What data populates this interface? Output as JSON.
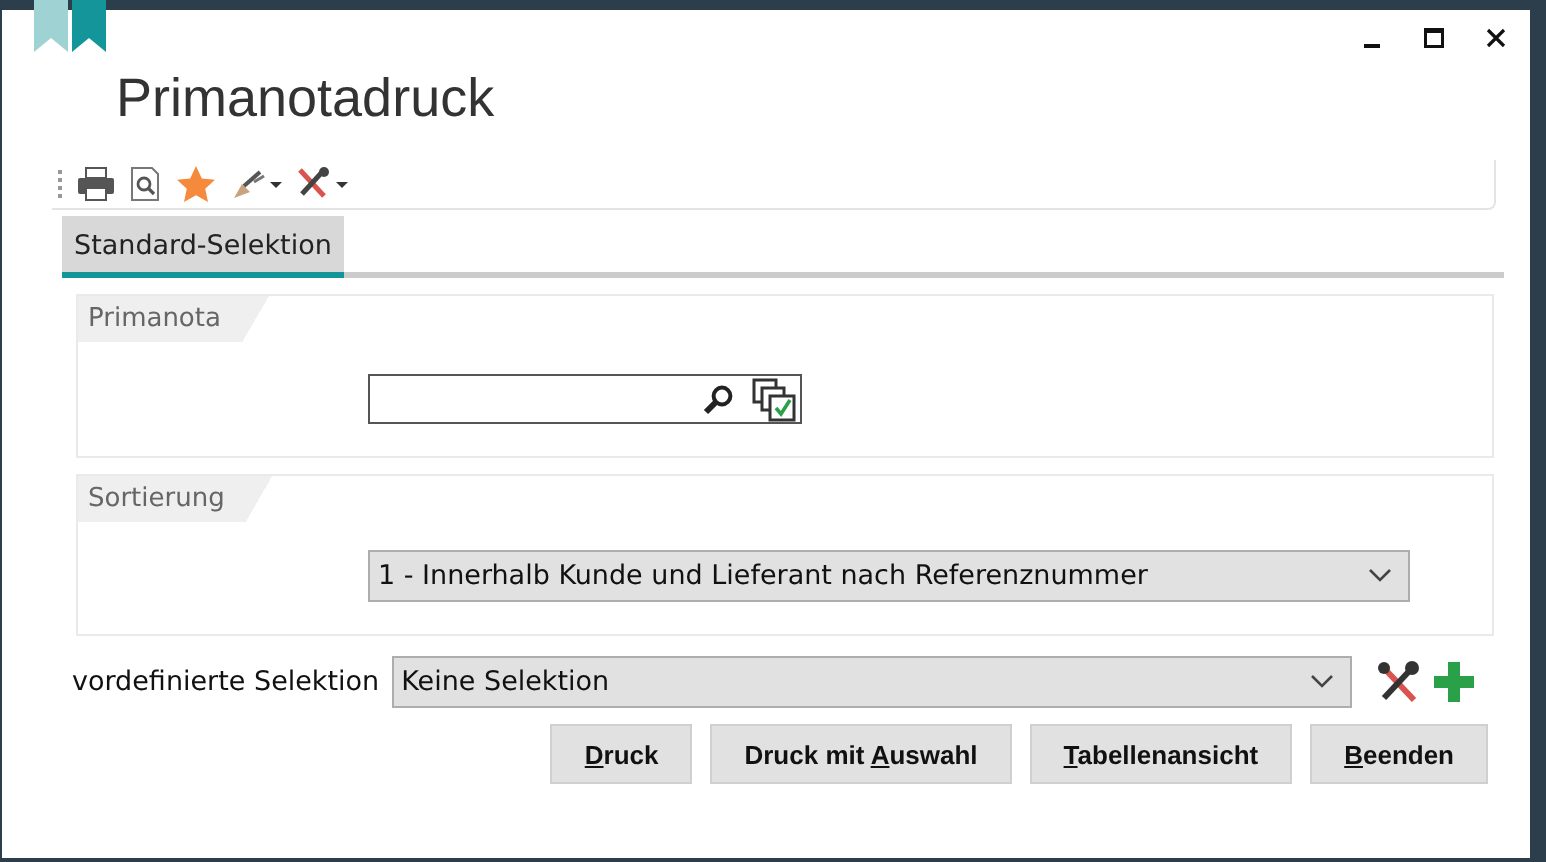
{
  "window": {
    "title": "Primanotadruck"
  },
  "tabs": [
    {
      "label": "Standard-Selektion",
      "selected": true
    }
  ],
  "groups": [
    {
      "title": "Primanota",
      "kind": "lookup"
    },
    {
      "title": "Sortierung",
      "kind": "dropdown",
      "value": "1 - Innerhalb Kunde und Lieferant nach Referenznummer"
    }
  ],
  "predefined": {
    "label": "vordefinierte Selektion",
    "value": "Keine Selektion"
  },
  "buttons": [
    {
      "key": "D",
      "post": "ruck"
    },
    {
      "pre": "Druck mit ",
      "key": "A",
      "post": "uswahl"
    },
    {
      "key": "T",
      "post": "abellenansicht"
    },
    {
      "key": "B",
      "post": "eenden"
    }
  ]
}
